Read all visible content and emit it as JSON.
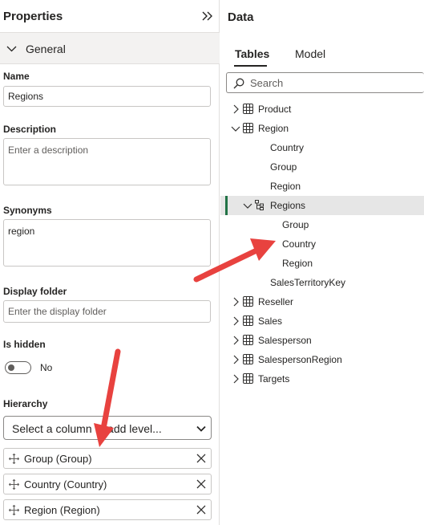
{
  "properties": {
    "title": "Properties",
    "section": "General",
    "name_label": "Name",
    "name_value": "Regions",
    "description_label": "Description",
    "description_placeholder": "Enter a description",
    "synonyms_label": "Synonyms",
    "synonyms_value": "region",
    "display_folder_label": "Display folder",
    "display_folder_placeholder": "Enter the display folder",
    "is_hidden_label": "Is hidden",
    "is_hidden_value": "No",
    "hierarchy_label": "Hierarchy",
    "hierarchy_select": "Select a column to add level...",
    "levels": [
      "Group (Group)",
      "Country (Country)",
      "Region (Region)"
    ]
  },
  "data_pane": {
    "title": "Data",
    "tabs": [
      "Tables",
      "Model"
    ],
    "active_tab": "Tables",
    "search_placeholder": "Search",
    "tree": {
      "product": "Product",
      "region": "Region",
      "region_country": "Country",
      "region_group": "Group",
      "region_region": "Region",
      "regions_hierarchy": "Regions",
      "h_group": "Group",
      "h_country": "Country",
      "h_region": "Region",
      "sales_territory_key": "SalesTerritoryKey",
      "reseller": "Reseller",
      "sales": "Sales",
      "salesperson": "Salesperson",
      "salesperson_region": "SalespersonRegion",
      "targets": "Targets"
    }
  },
  "colors": {
    "accent_selected": "#217346",
    "annotation_arrow": "#e8423f",
    "selected_row": "#e6e6e6",
    "section_bar": "#f3f2f1"
  },
  "icons": {
    "collapse": "double-chevron-right-icon",
    "table": "table-icon",
    "hierarchy": "hierarchy-icon",
    "search": "search-icon",
    "drag": "move-arrows-icon",
    "remove": "close-icon"
  }
}
